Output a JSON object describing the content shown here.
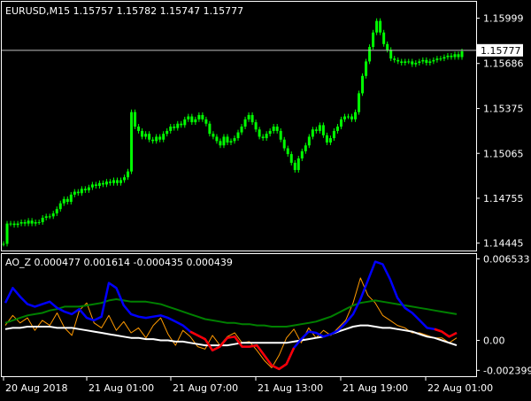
{
  "header": {
    "main_label": "EURUSD,M15  1.15757 1.15782 1.15747 1.15777",
    "indicator_label": "AO_Z 0.000477 0.001614 -0.000435 0.000439"
  },
  "colors": {
    "background": "#000000",
    "frame": "#ffffff",
    "candle": "#00ff00",
    "price_line": "#c0c0c0",
    "price_box_bg": "#ffffff",
    "price_box_text": "#000000",
    "blue_line": "#0000ff",
    "red_line": "#ff0000",
    "green_line": "#008000",
    "white_line": "#ffffff",
    "orange_line": "#ff9900"
  },
  "chart_data": [
    {
      "type": "candlestick",
      "title": "EURUSD,M15",
      "current_price": 1.15777,
      "current_price_label": "1.15777",
      "ylim": [
        1.144,
        1.161
      ],
      "y_ticks": [
        1.15999,
        1.15686,
        1.15375,
        1.15065,
        1.14755,
        1.14445
      ],
      "y_tick_labels": [
        "1.15999",
        "1.15686",
        "1.15375",
        "1.15065",
        "1.14755",
        "1.14445"
      ],
      "x_tick_labels": [
        "20 Aug 2018",
        "21 Aug 01:00",
        "21 Aug 07:00",
        "21 Aug 13:00",
        "21 Aug 19:00",
        "22 Aug 01:00"
      ],
      "close_series": [
        1.1444,
        1.1458,
        1.1458,
        1.1457,
        1.1458,
        1.1459,
        1.1458,
        1.146,
        1.1458,
        1.1459,
        1.1459,
        1.1462,
        1.1463,
        1.1463,
        1.1465,
        1.1468,
        1.1472,
        1.1475,
        1.1473,
        1.1478,
        1.148,
        1.1479,
        1.1482,
        1.1481,
        1.1483,
        1.1485,
        1.1484,
        1.1486,
        1.1485,
        1.1487,
        1.1486,
        1.1488,
        1.1486,
        1.1488,
        1.149,
        1.1494,
        1.1535,
        1.1525,
        1.1522,
        1.1518,
        1.152,
        1.1516,
        1.1515,
        1.1518,
        1.1516,
        1.152,
        1.1522,
        1.1525,
        1.1524,
        1.1527,
        1.1526,
        1.153,
        1.1532,
        1.1528,
        1.153,
        1.1533,
        1.153,
        1.1527,
        1.152,
        1.1518,
        1.1515,
        1.1512,
        1.1518,
        1.1514,
        1.1515,
        1.1517,
        1.1521,
        1.1525,
        1.153,
        1.1533,
        1.1528,
        1.1523,
        1.1518,
        1.1517,
        1.152,
        1.1522,
        1.1525,
        1.1522,
        1.1516,
        1.151,
        1.1506,
        1.15,
        1.1495,
        1.1503,
        1.1508,
        1.1512,
        1.1518,
        1.1523,
        1.1522,
        1.1526,
        1.1519,
        1.1514,
        1.1517,
        1.1522,
        1.1525,
        1.153,
        1.1532,
        1.1532,
        1.153,
        1.1535,
        1.1548,
        1.156,
        1.157,
        1.158,
        1.159,
        1.1598,
        1.159,
        1.1582,
        1.1578,
        1.1572,
        1.1571,
        1.157,
        1.1569,
        1.157,
        1.157,
        1.1568,
        1.1569,
        1.157,
        1.1571,
        1.1569,
        1.157,
        1.1571,
        1.1572,
        1.1572,
        1.1573,
        1.1574,
        1.1573,
        1.1575,
        1.1573,
        1.1577
      ]
    },
    {
      "type": "line",
      "title": "AO_Z",
      "ylim": [
        -0.0028,
        0.0067
      ],
      "y_ticks": [
        0.006533,
        0.0,
        -0.002399
      ],
      "y_tick_labels": [
        "0.006533",
        "0.00",
        "-0.002399"
      ],
      "series": [
        {
          "color": "blue_line",
          "values": [
            0.003,
            0.0042,
            0.0035,
            0.0029,
            0.0027,
            0.0029,
            0.0031,
            0.0026,
            0.0023,
            0.0021,
            0.0025,
            0.0018,
            0.0016,
            0.0019,
            0.0046,
            0.0042,
            0.0028,
            0.0021,
            0.0019,
            0.0018,
            0.0019,
            0.002,
            0.0018,
            0.0015,
            0.0012,
            0.0007,
            0.0004,
            0.0001,
            -0.0008,
            -0.0005,
            0.0002,
            0.0003,
            -0.0005,
            -0.0005,
            -0.0004,
            -0.0012,
            -0.002,
            -0.0023,
            -0.0019,
            -0.0006,
            0.0001,
            0.0007,
            0.0006,
            0.0003,
            0.0005,
            0.0008,
            0.0014,
            0.0021,
            0.0033,
            0.0048,
            0.0063,
            0.0061,
            0.0049,
            0.0034,
            0.0026,
            0.0022,
            0.0016,
            0.001,
            0.0009,
            0.0007,
            0.0003,
            0.0006
          ]
        },
        {
          "color": "red_line",
          "values": [
            null,
            null,
            null,
            null,
            null,
            null,
            null,
            null,
            null,
            null,
            null,
            null,
            null,
            null,
            null,
            null,
            null,
            null,
            null,
            null,
            null,
            null,
            null,
            null,
            null,
            0.0007,
            0.0004,
            0.0001,
            -0.0008,
            -0.0005,
            0.0002,
            0.0003,
            -0.0005,
            -0.0005,
            -0.0004,
            -0.0012,
            -0.002,
            -0.0023,
            -0.0019,
            -0.0006,
            null,
            null,
            null,
            null,
            null,
            null,
            null,
            null,
            null,
            null,
            null,
            null,
            null,
            null,
            null,
            null,
            null,
            null,
            0.0009,
            0.0007,
            0.0003,
            0.0006
          ]
        },
        {
          "color": "green_line",
          "values": [
            0.0014,
            0.0016,
            0.0018,
            0.002,
            0.0021,
            0.0022,
            0.0024,
            0.0025,
            0.0027,
            0.0027,
            0.0027,
            0.0028,
            0.0029,
            0.003,
            0.0032,
            0.0033,
            0.0032,
            0.0031,
            0.0031,
            0.0031,
            0.003,
            0.0029,
            0.0027,
            0.0025,
            0.0023,
            0.0021,
            0.0019,
            0.0017,
            0.0016,
            0.0015,
            0.0014,
            0.0014,
            0.0013,
            0.0013,
            0.0012,
            0.0012,
            0.0011,
            0.0011,
            0.0011,
            0.0012,
            0.0013,
            0.0014,
            0.0015,
            0.0017,
            0.0019,
            0.0022,
            0.0025,
            0.0028,
            0.003,
            0.0031,
            0.0032,
            0.0031,
            0.003,
            0.0029,
            0.0028,
            0.0027,
            0.0026,
            0.0025,
            0.0024,
            0.0023,
            0.0022,
            0.0021
          ]
        },
        {
          "color": "white_line",
          "values": [
            0.0009,
            0.001,
            0.001,
            0.0011,
            0.0011,
            0.0011,
            0.0011,
            0.001,
            0.001,
            0.001,
            0.0009,
            0.0008,
            0.0007,
            0.0006,
            0.0005,
            0.0004,
            0.0003,
            0.0002,
            0.0002,
            0.0001,
            0.0001,
            0.0,
            0.0,
            -0.0001,
            -0.0001,
            -0.0002,
            -0.0003,
            -0.0004,
            -0.0004,
            -0.0004,
            -0.0004,
            -0.0003,
            -0.0002,
            -0.0002,
            -0.0002,
            -0.0002,
            -0.0002,
            -0.0002,
            -0.0002,
            -0.0001,
            0.0,
            0.0001,
            0.0002,
            0.0003,
            0.0005,
            0.0007,
            0.0009,
            0.0011,
            0.0012,
            0.0012,
            0.0011,
            0.001,
            0.001,
            0.0009,
            0.0008,
            0.0007,
            0.0005,
            0.0003,
            0.0002,
            0.0,
            -0.0002,
            -0.0004
          ]
        },
        {
          "color": "orange_line",
          "values": [
            0.0012,
            0.002,
            0.0014,
            0.0018,
            0.0008,
            0.0016,
            0.0012,
            0.0022,
            0.001,
            0.0004,
            0.0024,
            0.003,
            0.0014,
            0.001,
            0.002,
            0.0008,
            0.0015,
            0.0006,
            0.001,
            0.0002,
            0.0012,
            0.0018,
            0.0005,
            -0.0004,
            0.0008,
            0.0003,
            -0.0005,
            -0.0007,
            0.0004,
            -0.0004,
            0.0003,
            0.0006,
            -0.0002,
            -0.0001,
            -0.0008,
            -0.0016,
            -0.0022,
            -0.0012,
            0.0002,
            0.0009,
            -0.0002,
            0.001,
            0.0002,
            0.0008,
            0.0004,
            0.001,
            0.0016,
            0.003,
            0.005,
            0.0036,
            0.003,
            0.002,
            0.0016,
            0.0012,
            0.001,
            0.0006,
            0.0006,
            0.0004,
            0.0002,
            0.0002,
            -0.0002,
            0.0002
          ]
        }
      ]
    }
  ]
}
